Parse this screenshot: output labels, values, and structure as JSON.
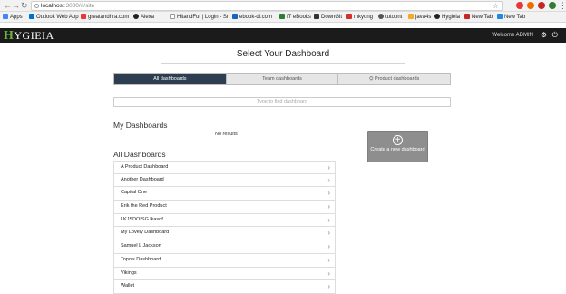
{
  "browser": {
    "url_host": "localhost",
    "url_rest": ":3000/#/site",
    "bookmarks": [
      {
        "label": "Apps",
        "color": "#4285f4"
      },
      {
        "label": "Outlook Web App",
        "color": "#0072c6"
      },
      {
        "label": "greatandhra.com",
        "color": "#e53935"
      },
      {
        "label": "Alexa",
        "color": "#222"
      },
      {
        "label": "HitandFut | Login - Sr",
        "color": "#888"
      },
      {
        "label": "ebook-dl.com",
        "color": "#1565c0"
      },
      {
        "label": "IT eBooks",
        "color": "#2e7d32"
      },
      {
        "label": "DownGit",
        "color": "#333"
      },
      {
        "label": "mkyong",
        "color": "#d32f2f"
      },
      {
        "label": "tutopnt",
        "color": "#555"
      },
      {
        "label": "java4s",
        "color": "#f9a825"
      },
      {
        "label": "Hygieia",
        "color": "#222"
      },
      {
        "label": "New Tab",
        "color": "#c62828"
      },
      {
        "label": "New Tab",
        "color": "#1e88e5"
      }
    ]
  },
  "app": {
    "logo_initial": "H",
    "logo_rest": "YGIEIA",
    "welcome": "Welcome ADMIN",
    "settings_icon": "gear-icon",
    "logout_icon": "power-icon"
  },
  "main": {
    "title": "Select Your Dashboard",
    "tabs": [
      {
        "label": "All dashboards"
      },
      {
        "label": "Team dashboards"
      },
      {
        "label": "⛭ Product dashboards"
      }
    ],
    "search_placeholder": "Type to find dashboard",
    "my_heading": "My Dashboards",
    "no_results": "No results",
    "create_label": "Create a new dashboard",
    "all_heading": "All Dashboards",
    "dashboards": [
      "A Product Dashboard",
      "Another Dashboard",
      "Capital One",
      "Erik the Red Product",
      "LKJSDOISG lkasdf",
      "My Lovely Dashboard",
      "Samuel L Jackson",
      "Topo's Dashboard",
      "Vikings",
      "Wallet"
    ]
  }
}
